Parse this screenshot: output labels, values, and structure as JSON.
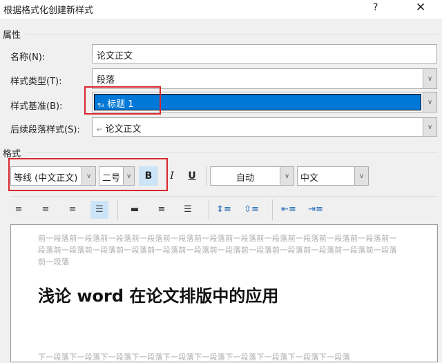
{
  "dialog": {
    "title": "根据格式化创建新样式",
    "help": "?",
    "close": "✕"
  },
  "properties": {
    "section": "属性",
    "name_label": "名称(N):",
    "name_value": "论文正文",
    "type_label": "样式类型(T):",
    "type_value": "段落",
    "base_label": "样式基准(B):",
    "base_icon": "¶a",
    "base_value": "标题 1",
    "next_label": "后续段落样式(S):",
    "next_icon": "↵",
    "next_value": "论文正文"
  },
  "format": {
    "section": "格式",
    "font": "等线 (中文正文)",
    "size": "二号",
    "bold": "B",
    "italic": "I",
    "underline": "U",
    "color": "自动",
    "script": "中文"
  },
  "preview": {
    "prev_text": "前一段落前一段落前一段落前一段落前一段落前一段落前一段落前一段落前一段落前一段落前一段落前一段落前一段落前一段落前一段落前一段落前一段落前一段落前一段落前一段落前一段落前一段落前一段落前一段落",
    "heading": "浅论 word 在论文排版中的应用",
    "next_text": "下一段落下一段落下一段落下一段落下一段落下一段落下一段落下一段落下一段落下一段落"
  },
  "colors": {
    "selection": "#0078d7",
    "highlight_box": "#d9262c",
    "active_button": "#cce4f7"
  }
}
